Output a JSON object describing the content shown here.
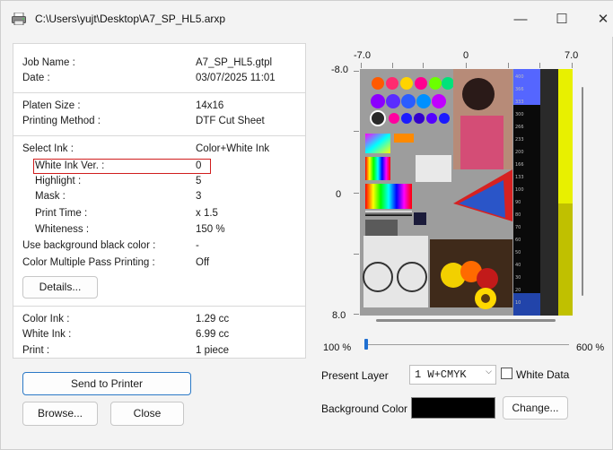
{
  "window": {
    "title": "C:\\Users\\yujt\\Desktop\\A7_SP_HL5.arxp",
    "minimize": "—",
    "maximize": "☐",
    "close": "✕"
  },
  "info": {
    "job_name_label": "Job Name :",
    "job_name_value": "A7_SP_HL5.gtpl",
    "date_label": "Date :",
    "date_value": "03/07/2025 11:01",
    "platen_label": "Platen Size :",
    "platen_value": "14x16",
    "method_label": "Printing Method :",
    "method_value": "DTF Cut Sheet",
    "select_ink_label": "Select Ink :",
    "select_ink_value": "Color+White Ink",
    "white_ink_ver_label": "White Ink Ver. :",
    "white_ink_ver_value": "0",
    "highlight_label": "Highlight :",
    "highlight_value": "5",
    "mask_label": "Mask :",
    "mask_value": "3",
    "print_time_label": "Print Time :",
    "print_time_value": "x 1.5",
    "whiteness_label": "Whiteness :",
    "whiteness_value": "150 %",
    "bg_black_label": "Use background black color :",
    "bg_black_value": "-",
    "multipass_label": "Color Multiple Pass Printing :",
    "multipass_value": "Off",
    "details_button": "Details...",
    "color_ink_label": "Color Ink :",
    "color_ink_value": "1.29 cc",
    "white_ink_label": "White Ink :",
    "white_ink_value": "6.99 cc",
    "print_label": "Print :",
    "print_value": "1 piece"
  },
  "buttons": {
    "send": "Send to Printer",
    "browse": "Browse...",
    "close": "Close",
    "change": "Change..."
  },
  "preview": {
    "x_min": "-7.0",
    "x_mid": "0",
    "x_max": "7.0",
    "y_top": "-8.0",
    "y_mid": "0",
    "y_bottom": "8.0",
    "zoom_min": "100 %",
    "zoom_max": "600 %",
    "zoom_level": 0
  },
  "layer": {
    "label": "Present Layer",
    "selected": "1 W+CMYK",
    "white_data_label": "White Data",
    "white_data_checked": false
  },
  "background": {
    "label": "Background Color",
    "color": "#000000"
  },
  "scale_numbers": [
    "400",
    "366",
    "333",
    "300",
    "266",
    "233",
    "200",
    "166",
    "133",
    "100",
    "90",
    "80",
    "70",
    "60",
    "50",
    "40",
    "30",
    "20",
    "10"
  ]
}
